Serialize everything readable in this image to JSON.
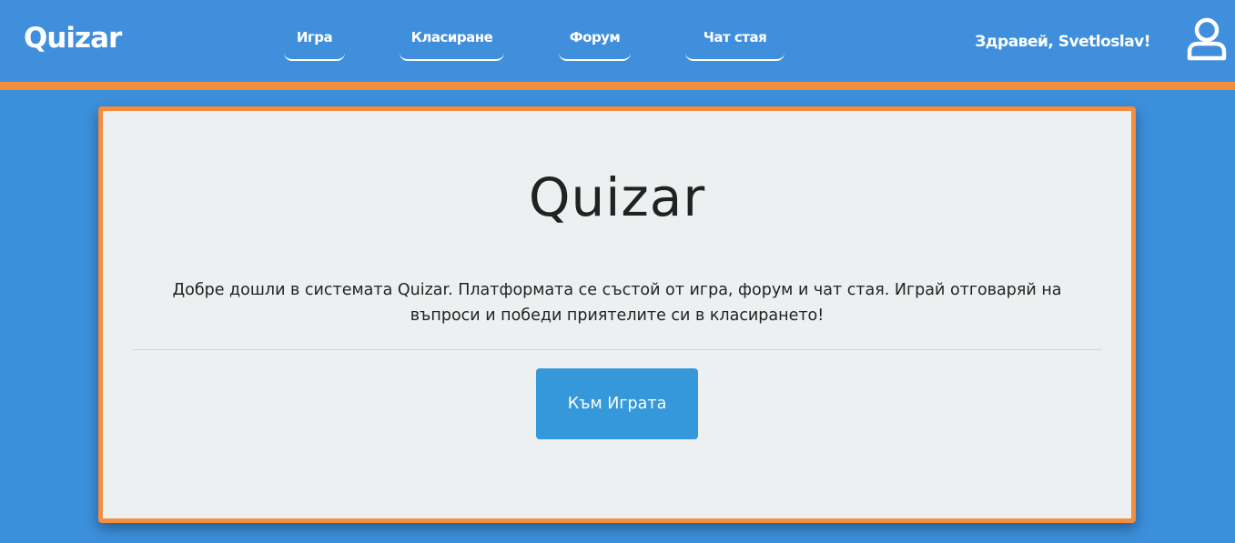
{
  "navbar": {
    "logo": "Quizar",
    "items": [
      {
        "label": "Игра"
      },
      {
        "label": "Класиране"
      },
      {
        "label": "Форум"
      },
      {
        "label": "Чат стая"
      }
    ],
    "greeting": "Здравей, Svetloslav!",
    "user_icon": "user-icon"
  },
  "main": {
    "title": "Quizar",
    "description": "Добре дошли в системата Quizar. Платформата се състой от игра, форум и чат стая. Играй отговаряй на въпроси и победи приятелите си в класирането!",
    "button_label": "Към Играта"
  },
  "colors": {
    "background": "#3b8fdb",
    "accent": "#f58d3f",
    "card": "#ecf0f1",
    "button": "#3498db"
  }
}
